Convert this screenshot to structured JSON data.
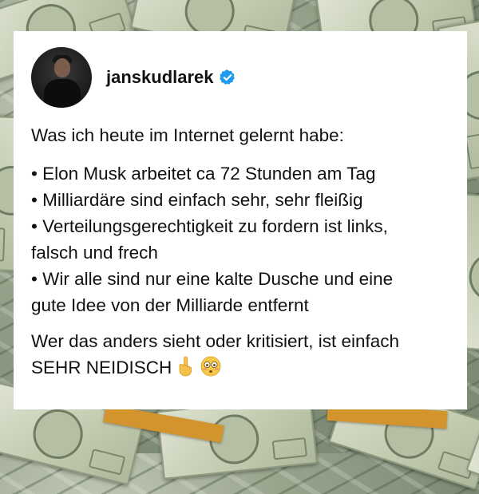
{
  "post": {
    "username": "janskudlarek",
    "verified": true,
    "intro": "Was ich heute im Internet gelernt habe:",
    "bullets": [
      "• Elon Musk arbeitet ca 72 Stunden am Tag",
      "• Milliardäre sind einfach sehr, sehr fleißig",
      "• Verteilungsgerechtigkeit zu fordern ist links,",
      "falsch und frech",
      "• Wir alle sind nur eine kalte Dusche und eine",
      "gute Idee von der Milliarde entfernt"
    ],
    "closing_line1": "Wer das anders sieht oder kritisiert, ist einfach",
    "closing_line2": "SEHR NEIDISCH",
    "emojis": [
      "raised-hand-emoji",
      "flushed-face-emoji"
    ]
  },
  "colors": {
    "verified_badge": "#1d9bf0",
    "text": "#111111",
    "card": "#ffffff"
  }
}
